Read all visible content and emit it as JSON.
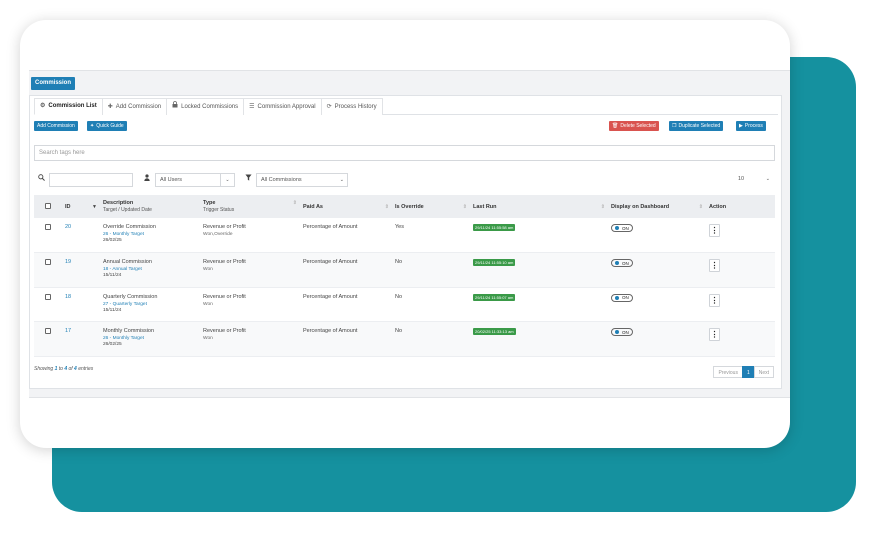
{
  "module_label": "Commission",
  "tabs": [
    {
      "label": "Commission List",
      "icon": "gears-icon"
    },
    {
      "label": "Add Commission",
      "icon": "plus-icon"
    },
    {
      "label": "Locked Commissions",
      "icon": "lock-icon"
    },
    {
      "label": "Commission Approval",
      "icon": "list-icon"
    },
    {
      "label": "Process History",
      "icon": "refresh-icon"
    }
  ],
  "toolbar": {
    "add_commission": "Add Commission",
    "quick_guide": "Quick Guide",
    "delete_selected": "Delete Selected",
    "duplicate_selected": "Duplicate Selected",
    "process": "Process"
  },
  "search_tags_placeholder": "Search tags here",
  "filters": {
    "users": "All Users",
    "commissions": "All Commissions",
    "page_size": "10"
  },
  "columns": {
    "id": "ID",
    "description": "Description",
    "description_sub": "Target / Updated Date",
    "type": "Type",
    "type_sub": "Trigger Status",
    "paid_as": "Paid As",
    "is_override": "Is Override",
    "last_run": "Last Run",
    "display": "Display on Dashboard",
    "action": "Action"
  },
  "rows": [
    {
      "id": "20",
      "description": "Override Commission",
      "target": "26 - Monthly Target",
      "date": "26/02/25",
      "type": "Revenue or Profit",
      "trigger": "Won,Override",
      "paid_as": "Percentage of Amount",
      "is_override": "Yes",
      "last_run": "29/11/24 11:55:58 am",
      "display": "ON"
    },
    {
      "id": "19",
      "description": "Annual Commission",
      "target": "18 - Annual Target",
      "date": "15/11/24",
      "type": "Revenue or Profit",
      "trigger": "Won",
      "paid_as": "Percentage of Amount",
      "is_override": "No",
      "last_run": "29/11/24 11:55:10 am",
      "display": "ON"
    },
    {
      "id": "18",
      "description": "Quarterly Commission",
      "target": "27 - Quarterly Target",
      "date": "15/11/24",
      "type": "Revenue or Profit",
      "trigger": "Won",
      "paid_as": "Percentage of Amount",
      "is_override": "No",
      "last_run": "29/11/24 11:55:07 am",
      "display": "ON"
    },
    {
      "id": "17",
      "description": "Monthly Commission",
      "target": "26 - Monthly Target",
      "date": "26/02/25",
      "type": "Revenue or Profit",
      "trigger": "Won",
      "paid_as": "Percentage of Amount",
      "is_override": "No",
      "last_run": "20/02/25 11:33:13 am",
      "display": "ON"
    }
  ],
  "footer": {
    "showing_prefix": "Showing",
    "from": "1",
    "to_word": "to",
    "to": "4",
    "of_word": "of",
    "total": "4",
    "suffix": "entries"
  },
  "pagination": {
    "previous": "Previous",
    "current": "1",
    "next": "Next"
  },
  "colors": {
    "teal_backdrop": "#15919f",
    "primary": "#1f7fb5",
    "danger": "#d9534f",
    "success": "#3a9a48"
  }
}
